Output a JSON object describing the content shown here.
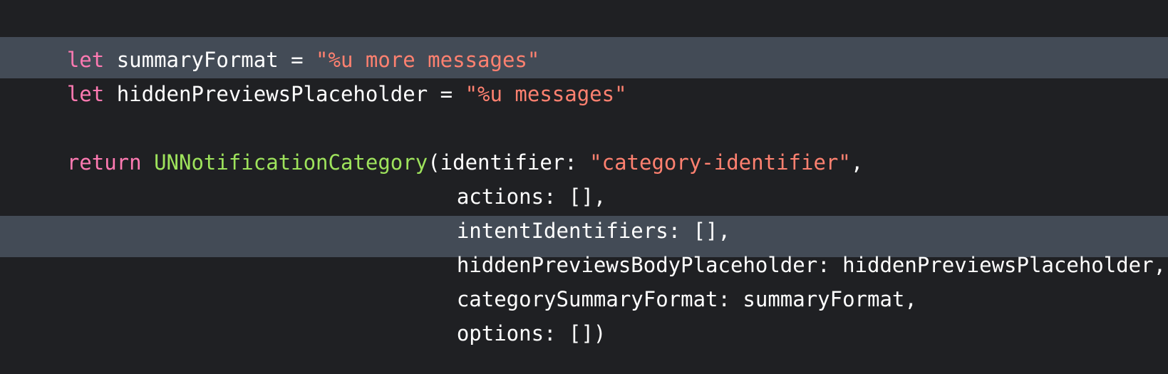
{
  "code": {
    "lines": [
      {
        "kw": "let",
        "t1": " summaryFormat = ",
        "str": "\"%u more messages\""
      },
      {
        "kw": "let",
        "t1": " hiddenPreviewsPlaceholder = ",
        "str": "\"%u messages\""
      },
      {
        "kw": "return",
        "type": "UNNotificationCategory",
        "t1": "(identifier: ",
        "str": "\"category-identifier\"",
        "t2": ","
      },
      {
        "text": "actions: [],"
      },
      {
        "text": "intentIdentifiers: [],"
      },
      {
        "text": "hiddenPreviewsBodyPlaceholder: hiddenPreviewsPlaceholder,"
      },
      {
        "text": "categorySummaryFormat: summaryFormat,"
      },
      {
        "text": "options: [])"
      }
    ]
  },
  "colors": {
    "background": "#1f2023",
    "highlight": "#434b56",
    "keyword": "#ff7ab2",
    "string": "#ff8170",
    "type": "#9ee35c",
    "plain": "#ffffff"
  }
}
